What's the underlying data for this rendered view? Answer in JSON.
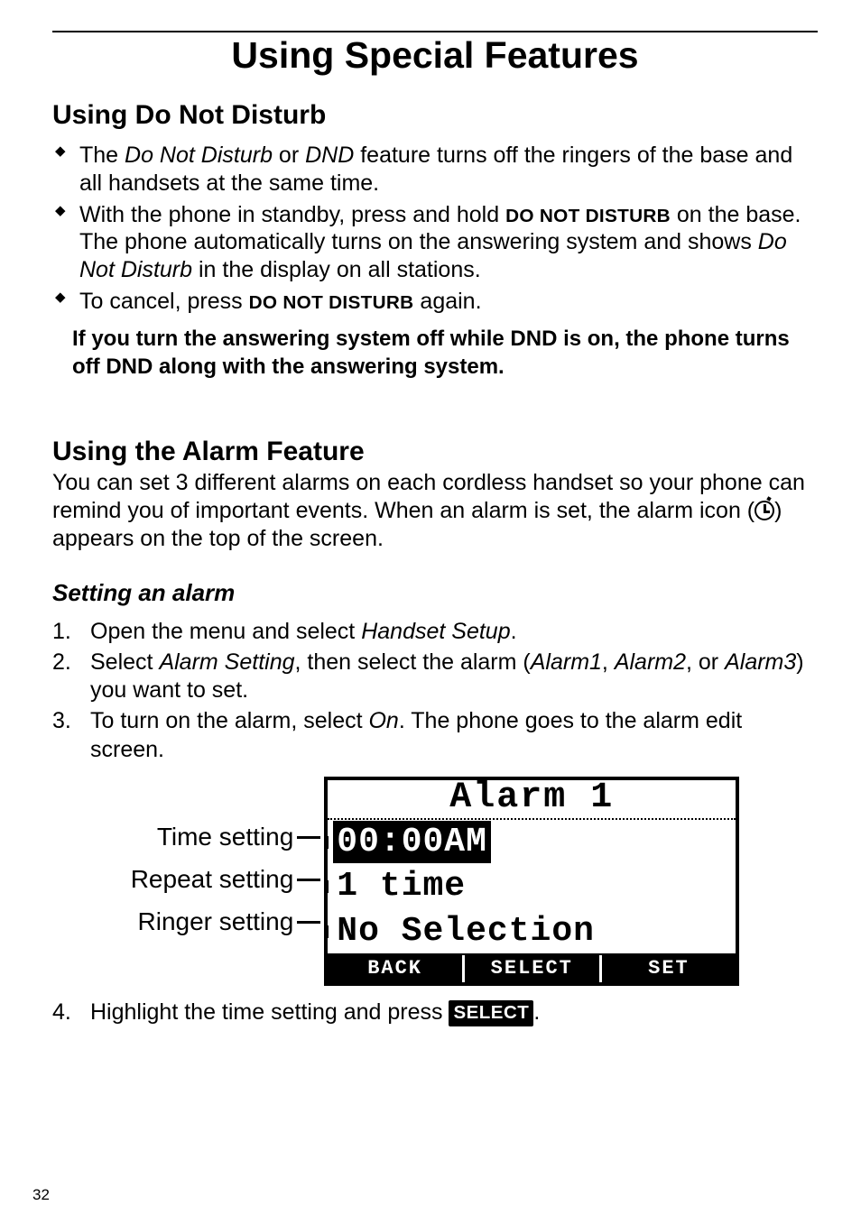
{
  "page": {
    "title": "Using Special Features",
    "number": "32"
  },
  "dnd": {
    "heading": "Using Do Not Disturb",
    "b1_a": "The ",
    "b1_i1": "Do Not Disturb",
    "b1_b": " or ",
    "b1_i2": "DND",
    "b1_c": " feature turns off the ringers of the base and all handsets at the same time.",
    "b2_a": "With the phone in standby, press and hold ",
    "b2_sc": "DO NOT DISTURB",
    "b2_b": " on the base. The phone automatically turns on the answering system and shows ",
    "b2_i": "Do Not Disturb",
    "b2_c": " in the display on all stations.",
    "b3_a": "To cancel, press ",
    "b3_sc": "DO NOT DISTURB",
    "b3_b": " again.",
    "note": "If you turn the answering system off while DND is on, the phone turns off DND along with the answering system."
  },
  "alarm": {
    "heading": "Using the Alarm Feature",
    "intro_a": "You can set 3 different alarms on each cordless handset so your phone can remind you of important events. When an alarm is set, the alarm icon (",
    "intro_b": ") appears on the top of the screen.",
    "sub": "Setting an alarm",
    "s1_a": "Open the menu and select ",
    "s1_i": "Handset Setup",
    "s1_b": ".",
    "s2_a": "Select ",
    "s2_i1": "Alarm Setting",
    "s2_b": ", then select the alarm (",
    "s2_i2": "Alarm1",
    "s2_c": ", ",
    "s2_i3": "Alarm2",
    "s2_d": ", or ",
    "s2_i4": "Alarm3",
    "s2_e": ") you want to set.",
    "s3_a": "To turn on the alarm, select ",
    "s3_i": "On",
    "s3_b": ". The phone goes to the alarm edit screen.",
    "s4_a": "Highlight the time setting and press ",
    "s4_pill": "SELECT",
    "s4_b": "."
  },
  "lcd": {
    "label_time": "Time setting",
    "label_repeat": "Repeat setting",
    "label_ringer": "Ringer setting",
    "title": "Alarm 1",
    "time": "00:00AM",
    "repeat": "1 time",
    "ringer": "No Selection",
    "soft_back": "BACK",
    "soft_select": "SELECT",
    "soft_set": "SET"
  }
}
